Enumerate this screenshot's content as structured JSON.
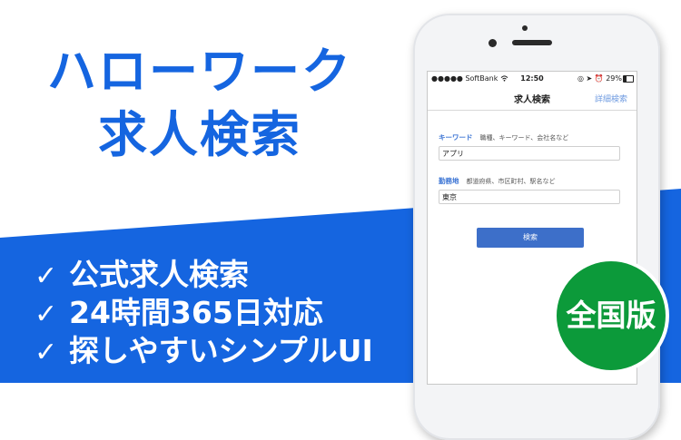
{
  "headline": {
    "line1": "ハローワーク",
    "line2": "求人検索"
  },
  "features": [
    {
      "check": "✓",
      "text": "公式求人検索"
    },
    {
      "check": "✓",
      "text": "24時間365日対応"
    },
    {
      "check": "✓",
      "text": "探しやすいシンプルUI"
    }
  ],
  "badge": {
    "text": "全国版"
  },
  "colors": {
    "brand_blue": "#1565e0",
    "badge_green": "#0c9a3a",
    "button_blue": "#3d6fc9"
  },
  "phone": {
    "status_bar": {
      "carrier": "●●●●● SoftBank",
      "wifi_icon": "wifi-icon",
      "time": "12:50",
      "right": "◎ ➤ ⏰ 29%",
      "battery_percent": 29
    },
    "nav": {
      "title": "求人検索",
      "detail": "詳細検索"
    },
    "keyword": {
      "label": "キーワード",
      "hint": "職種、キーワード、会社名など",
      "value": "アプリ"
    },
    "location": {
      "label": "勤務地",
      "hint": "都道府県、市区町村、駅名など",
      "value": "東京"
    },
    "search_button": "検索"
  }
}
